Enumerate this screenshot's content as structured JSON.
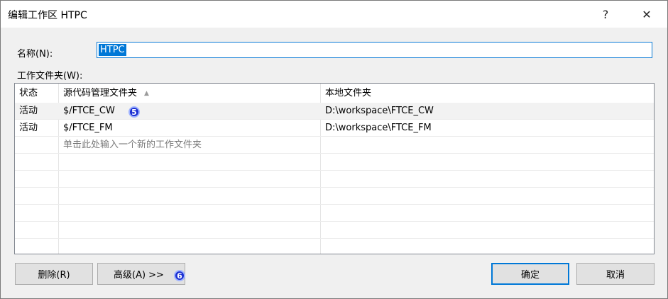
{
  "window": {
    "title": "编辑工作区 HTPC",
    "help_label": "?",
    "close_label": "✕"
  },
  "name_field": {
    "label": "名称(N):",
    "value": "HTPC"
  },
  "working_folders": {
    "label": "工作文件夹(W):",
    "columns": [
      "状态",
      "源代码管理文件夹",
      "本地文件夹"
    ],
    "sort_indicator": "▲",
    "rows": [
      {
        "status": "活动",
        "source": "$/FTCE_CW",
        "local": "D:\\workspace\\FTCE_CW"
      },
      {
        "status": "活动",
        "source": "$/FTCE_FM",
        "local": "D:\\workspace\\FTCE_FM"
      }
    ],
    "add_hint": "单击此处输入一个新的工作文件夹"
  },
  "markers": {
    "m5": "5",
    "m6": "6"
  },
  "buttons": {
    "delete": "删除(R)",
    "advanced": "高级(A) >>",
    "ok": "确定",
    "cancel": "取消"
  },
  "colors": {
    "accent": "#0078d7",
    "marker": "#1b2fd1"
  }
}
